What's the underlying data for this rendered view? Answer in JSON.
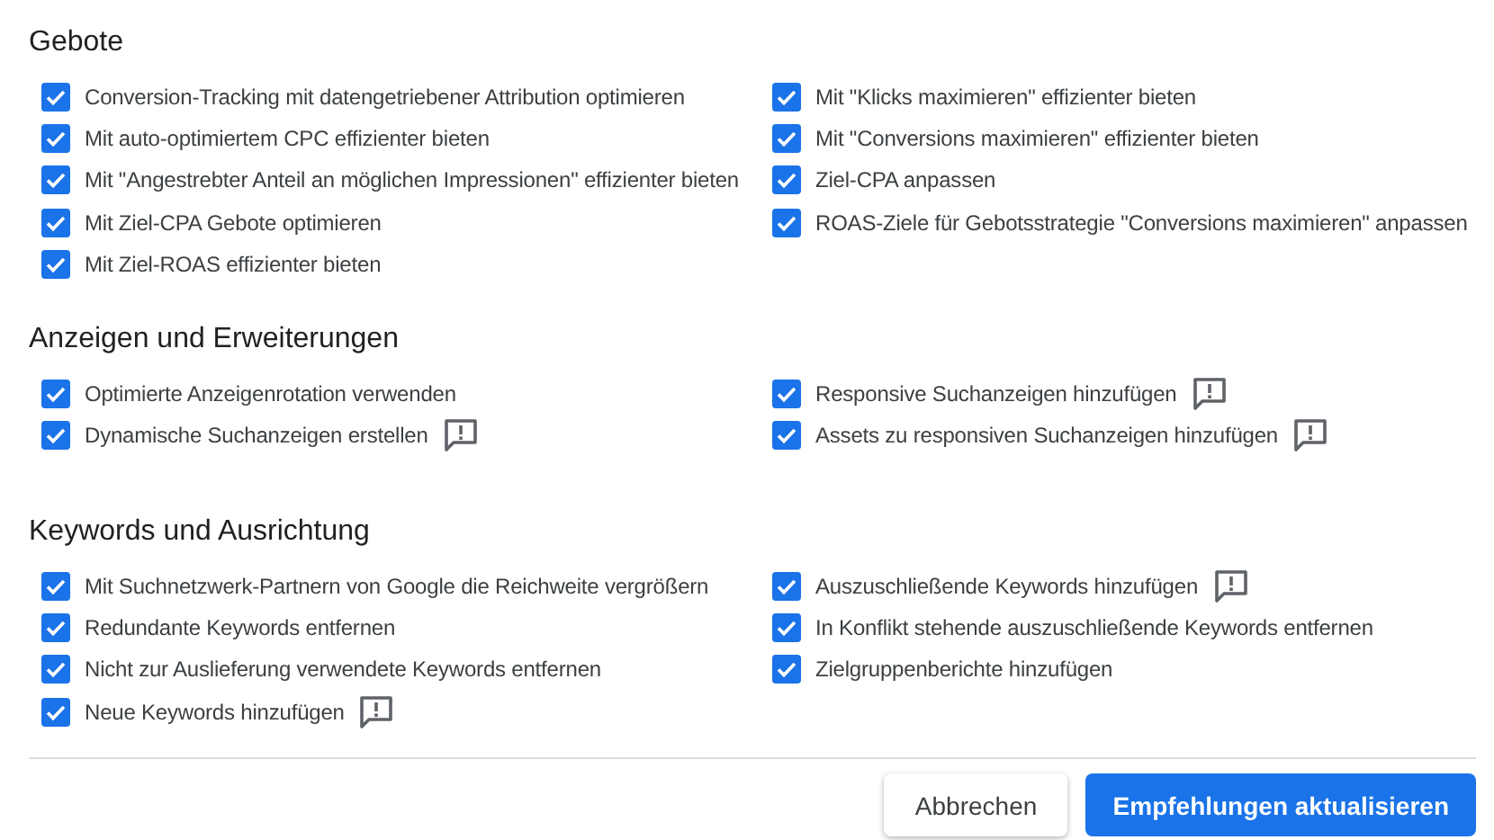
{
  "sections": [
    {
      "title": "Gebote",
      "columns": [
        [
          {
            "label": "Conversion-Tracking mit datengetriebener Attribution optimieren",
            "checked": true,
            "feedback": false
          },
          {
            "label": "Mit auto-optimiertem CPC effizienter bieten",
            "checked": true,
            "feedback": false
          },
          {
            "label": "Mit \"Angestrebter Anteil an möglichen Impressionen\" effizienter bieten",
            "checked": true,
            "feedback": false
          },
          {
            "label": "Mit Ziel-CPA Gebote optimieren",
            "checked": true,
            "feedback": false
          },
          {
            "label": "Mit Ziel-ROAS effizienter bieten",
            "checked": true,
            "feedback": false
          }
        ],
        [
          {
            "label": "Mit \"Klicks maximieren\" effizienter bieten",
            "checked": true,
            "feedback": false
          },
          {
            "label": "Mit \"Conversions maximieren\" effizienter bieten",
            "checked": true,
            "feedback": false
          },
          {
            "label": "Ziel-CPA anpassen",
            "checked": true,
            "feedback": false
          },
          {
            "label": "ROAS-Ziele für Gebotsstrategie \"Conversions maximieren\" anpassen",
            "checked": true,
            "feedback": false
          }
        ]
      ]
    },
    {
      "title": "Anzeigen und Erweiterungen",
      "columns": [
        [
          {
            "label": "Optimierte Anzeigenrotation verwenden",
            "checked": true,
            "feedback": false
          },
          {
            "label": "Dynamische Suchanzeigen erstellen",
            "checked": true,
            "feedback": true
          }
        ],
        [
          {
            "label": "Responsive Suchanzeigen hinzufügen",
            "checked": true,
            "feedback": true
          },
          {
            "label": "Assets zu responsiven Suchanzeigen hinzufügen",
            "checked": true,
            "feedback": true
          }
        ]
      ]
    },
    {
      "title": "Keywords und Ausrichtung",
      "columns": [
        [
          {
            "label": "Mit Suchnetzwerk-Partnern von Google die Reichweite vergrößern",
            "checked": true,
            "feedback": false
          },
          {
            "label": "Redundante Keywords entfernen",
            "checked": true,
            "feedback": false
          },
          {
            "label": "Nicht zur Auslieferung verwendete Keywords entfernen",
            "checked": true,
            "feedback": false
          },
          {
            "label": "Neue Keywords hinzufügen",
            "checked": true,
            "feedback": true
          }
        ],
        [
          {
            "label": "Auszuschließende Keywords hinzufügen",
            "checked": true,
            "feedback": true
          },
          {
            "label": "In Konflikt stehende auszuschließende Keywords entfernen",
            "checked": true,
            "feedback": false
          },
          {
            "label": "Zielgruppenberichte hinzufügen",
            "checked": true,
            "feedback": false
          }
        ]
      ]
    }
  ],
  "buttons": [
    {
      "label": "Abbrechen",
      "kind": "secondary"
    },
    {
      "label": "Empfehlungen aktualisieren",
      "kind": "primary"
    }
  ]
}
